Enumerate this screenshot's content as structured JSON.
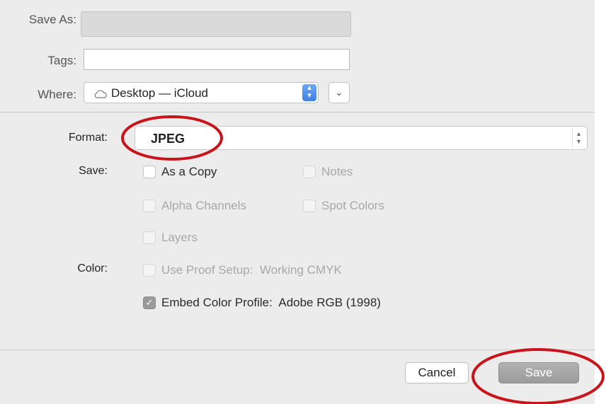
{
  "top": {
    "save_as_label": "Save As:",
    "save_as_value": "",
    "tags_label": "Tags:",
    "tags_value": "",
    "where_label": "Where:",
    "where_value": "Desktop — iCloud",
    "where_icon": "cloud-icon"
  },
  "format": {
    "label": "Format:",
    "value": "JPEG"
  },
  "save_options": {
    "label": "Save:",
    "as_a_copy": {
      "label": "As a Copy",
      "checked": false,
      "enabled": true
    },
    "notes": {
      "label": "Notes",
      "checked": false,
      "enabled": false
    },
    "alpha_channels": {
      "label": "Alpha Channels",
      "checked": false,
      "enabled": false
    },
    "spot_colors": {
      "label": "Spot Colors",
      "checked": false,
      "enabled": false
    },
    "layers": {
      "label": "Layers",
      "checked": false,
      "enabled": false
    }
  },
  "color_options": {
    "label": "Color:",
    "use_proof_setup": {
      "label": "Use Proof Setup:  Working CMYK",
      "checked": false,
      "enabled": false
    },
    "embed_color_profile": {
      "label": "Embed Color Profile:  Adobe RGB (1998)",
      "checked": true,
      "enabled": true
    }
  },
  "buttons": {
    "cancel": "Cancel",
    "save": "Save"
  },
  "colors": {
    "dialog_bg": "#ececec",
    "highlight_ring": "#c8141b",
    "stepper_blue": "#3f7fe6"
  }
}
